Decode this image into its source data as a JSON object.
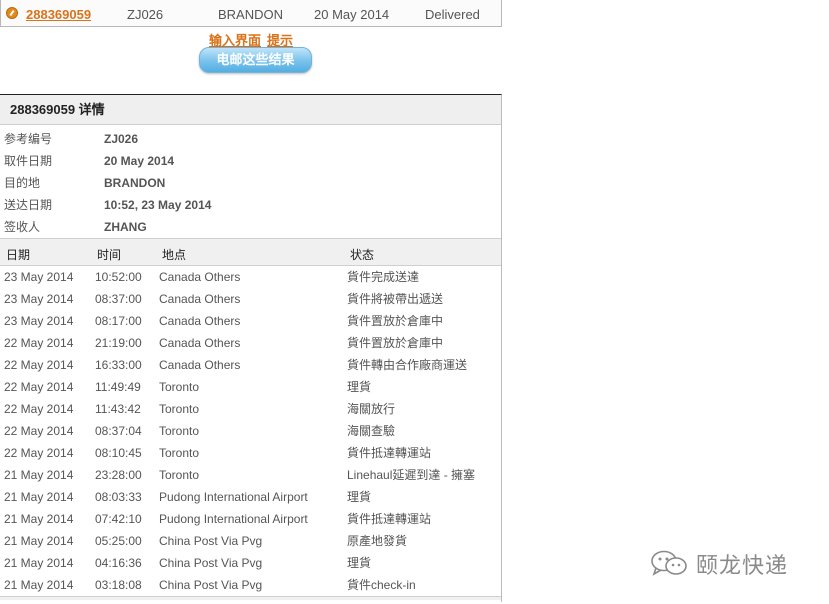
{
  "summary": {
    "tracking_no": "288369059",
    "reference": "ZJ026",
    "destination": "BRANDON",
    "date": "20 May 2014",
    "status": "Delivered"
  },
  "links": {
    "input_page": "输入界面",
    "tip": "提示"
  },
  "email_button": "电邮这些结果",
  "detail": {
    "title": "288369059 详情",
    "fields": [
      {
        "label": "参考编号",
        "value": "ZJ026"
      },
      {
        "label": "取件日期",
        "value": "20 May 2014"
      },
      {
        "label": "目的地",
        "value": "BRANDON"
      },
      {
        "label": "送达日期",
        "value": "10:52, 23 May 2014"
      },
      {
        "label": "签收人",
        "value": "ZHANG"
      }
    ]
  },
  "tracking": {
    "headers": {
      "date": "日期",
      "time": "时间",
      "location": "地点",
      "status": "状态"
    },
    "rows": [
      {
        "date": "23 May 2014",
        "time": "10:52:00",
        "location": "Canada Others",
        "status": "貨件完成送達"
      },
      {
        "date": "23 May 2014",
        "time": "08:37:00",
        "location": "Canada Others",
        "status": "貨件將被帶出遞送"
      },
      {
        "date": "23 May 2014",
        "time": "08:17:00",
        "location": "Canada Others",
        "status": "貨件置放於倉庫中"
      },
      {
        "date": "22 May 2014",
        "time": "21:19:00",
        "location": "Canada Others",
        "status": "貨件置放於倉庫中"
      },
      {
        "date": "22 May 2014",
        "time": "16:33:00",
        "location": "Canada Others",
        "status": "貨件轉由合作廠商運送"
      },
      {
        "date": "22 May 2014",
        "time": "11:49:49",
        "location": "Toronto",
        "status": "理貨"
      },
      {
        "date": "22 May 2014",
        "time": "11:43:42",
        "location": "Toronto",
        "status": "海關放行"
      },
      {
        "date": "22 May 2014",
        "time": "08:37:04",
        "location": "Toronto",
        "status": "海關查驗"
      },
      {
        "date": "22 May 2014",
        "time": "08:10:45",
        "location": "Toronto",
        "status": "貨件抵達轉運站"
      },
      {
        "date": "21 May 2014",
        "time": "23:28:00",
        "location": "Toronto",
        "status": "Linehaul延遲到達 - 擁塞"
      },
      {
        "date": "21 May 2014",
        "time": "08:03:33",
        "location": "Pudong International Airport",
        "status": "理貨"
      },
      {
        "date": "21 May 2014",
        "time": "07:42:10",
        "location": "Pudong International Airport",
        "status": "貨件抵達轉運站"
      },
      {
        "date": "21 May 2014",
        "time": "05:25:00",
        "location": "China Post Via Pvg",
        "status": "原產地發貨"
      },
      {
        "date": "21 May 2014",
        "time": "04:16:36",
        "location": "China Post Via Pvg",
        "status": "理貨"
      },
      {
        "date": "21 May 2014",
        "time": "03:18:08",
        "location": "China Post Via Pvg",
        "status": "貨件check-in"
      }
    ]
  },
  "watermark": {
    "text": "颐龙快递",
    "icon": "wechat-icon"
  }
}
